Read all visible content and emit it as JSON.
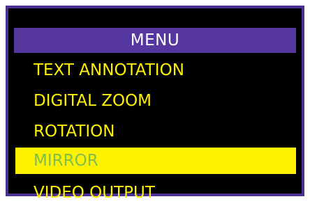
{
  "menu": {
    "title": "MENU",
    "items": [
      {
        "label": "TEXT ANNOTATION",
        "selected": false
      },
      {
        "label": "DIGITAL ZOOM",
        "selected": false
      },
      {
        "label": "ROTATION",
        "selected": false
      },
      {
        "label": "MIRROR",
        "selected": true
      },
      {
        "label": "VIDEO OUTPUT",
        "selected": false
      }
    ]
  },
  "colors": {
    "frame": "#4b3194",
    "header_background": "#56379f",
    "background": "#000000",
    "item_text": "#fff200",
    "selected_background": "#fff200",
    "selected_text": "#7fbf4d"
  }
}
